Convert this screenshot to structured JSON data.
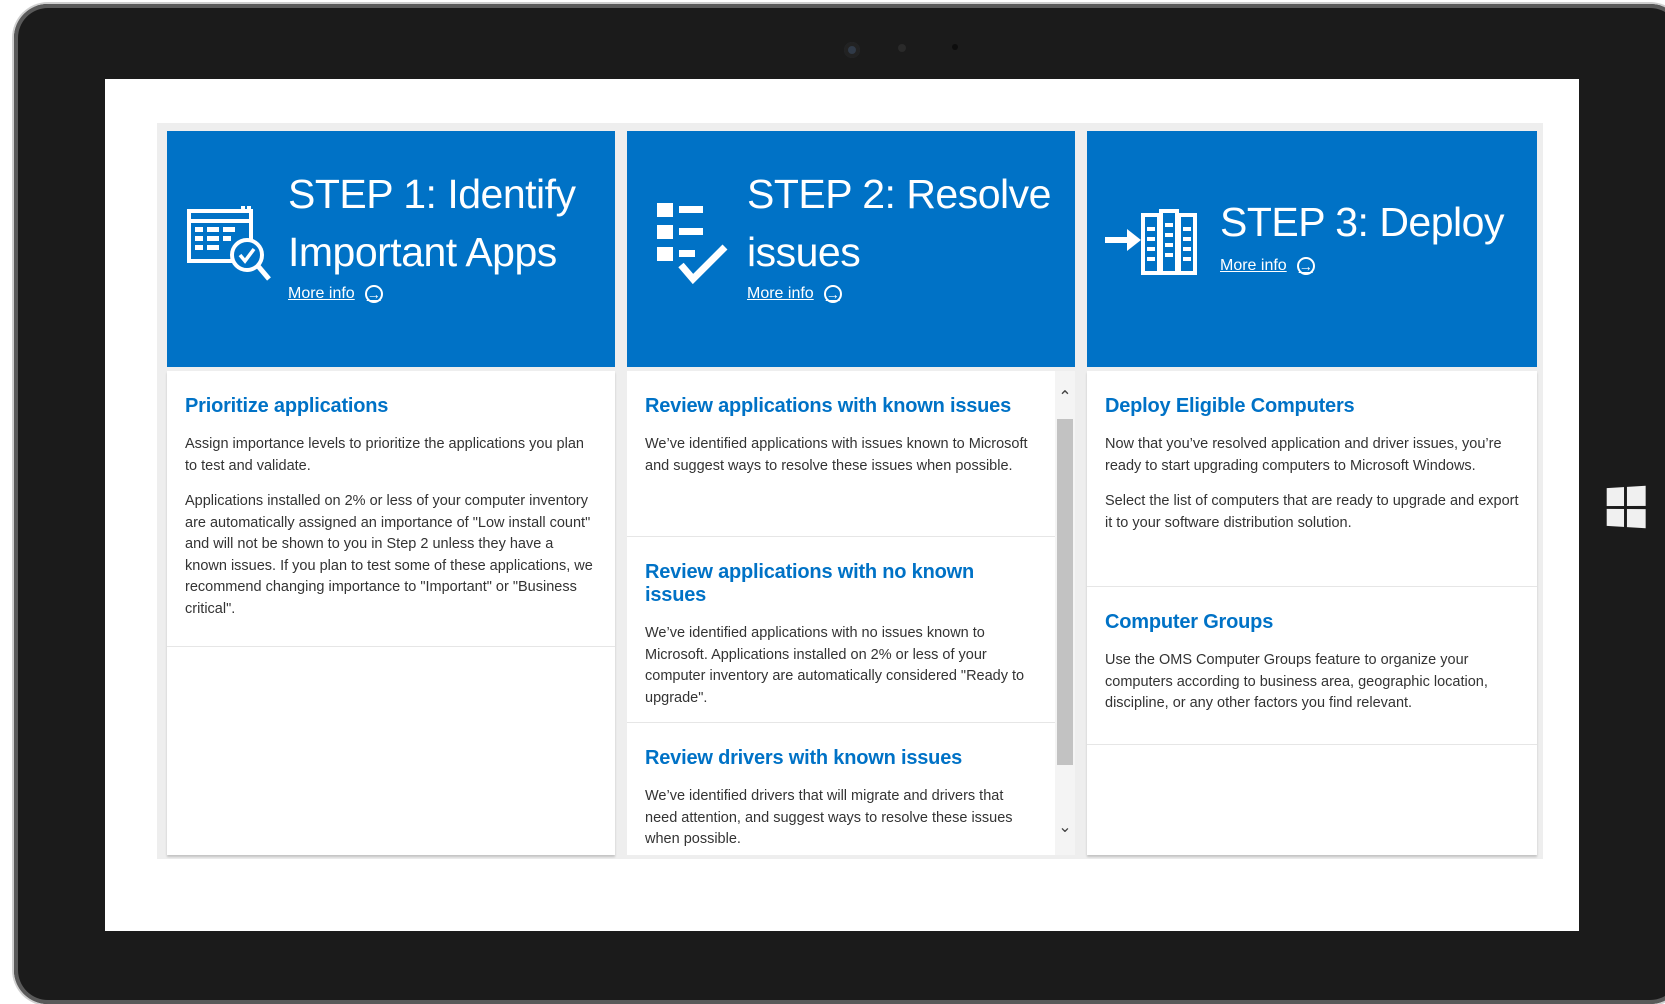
{
  "steps": [
    {
      "title_line1": "STEP 1: Identify",
      "title_line2": "Important Apps",
      "more_info": "More info",
      "sections": [
        {
          "heading": "Prioritize applications",
          "paragraphs": [
            "Assign importance levels to prioritize the applications you plan to test and validate.",
            "Applications installed on 2% or less of your computer inventory are automatically assigned an importance of \"Low install count\" and will not be shown to you in Step 2 unless they have a known issues. If you plan to test some of these applications, we recommend changing importance to \"Important\" or \"Business critical\"."
          ]
        }
      ]
    },
    {
      "title_line1": "STEP 2: Resolve",
      "title_line2": "issues",
      "more_info": "More info",
      "sections": [
        {
          "heading": "Review applications with known issues",
          "paragraphs": [
            "We’ve identified applications with issues known to Microsoft and suggest ways to resolve these issues when possible."
          ]
        },
        {
          "heading": "Review applications with no known issues",
          "paragraphs": [
            "We’ve identified applications with no issues known to Microsoft. Applications installed on 2% or less of your computer inventory are automatically considered \"Ready to upgrade\"."
          ]
        },
        {
          "heading": "Review drivers with known issues",
          "paragraphs": [
            "We’ve identified drivers that will migrate and drivers that need attention, and suggest ways to resolve these issues when possible."
          ]
        }
      ]
    },
    {
      "title_line1": "STEP 3: Deploy",
      "title_line2": "",
      "more_info": "More info",
      "sections": [
        {
          "heading": "Deploy Eligible Computers",
          "paragraphs": [
            "Now that you’ve resolved application and driver issues, you’re ready to start upgrading computers to Microsoft Windows.",
            "Select the list of computers that are ready to upgrade and export it to your software distribution solution."
          ]
        },
        {
          "heading": "Computer Groups",
          "paragraphs": [
            "Use the OMS Computer Groups feature to organize your computers according to business area, geographic location, discipline, or any other factors you find relevant."
          ]
        }
      ]
    }
  ],
  "icons": {
    "step1": "app-list-search-icon",
    "step2": "checklist-icon",
    "step3": "deploy-servers-icon",
    "more_info": "arrow-circle-right-icon",
    "hardware": "windows-logo-icon"
  },
  "colors": {
    "accent": "#0072c6",
    "board_bg": "#eeeeee",
    "text": "#333333"
  },
  "scrollbar": {
    "up_glyph": "⌃",
    "down_glyph": "⌄"
  }
}
